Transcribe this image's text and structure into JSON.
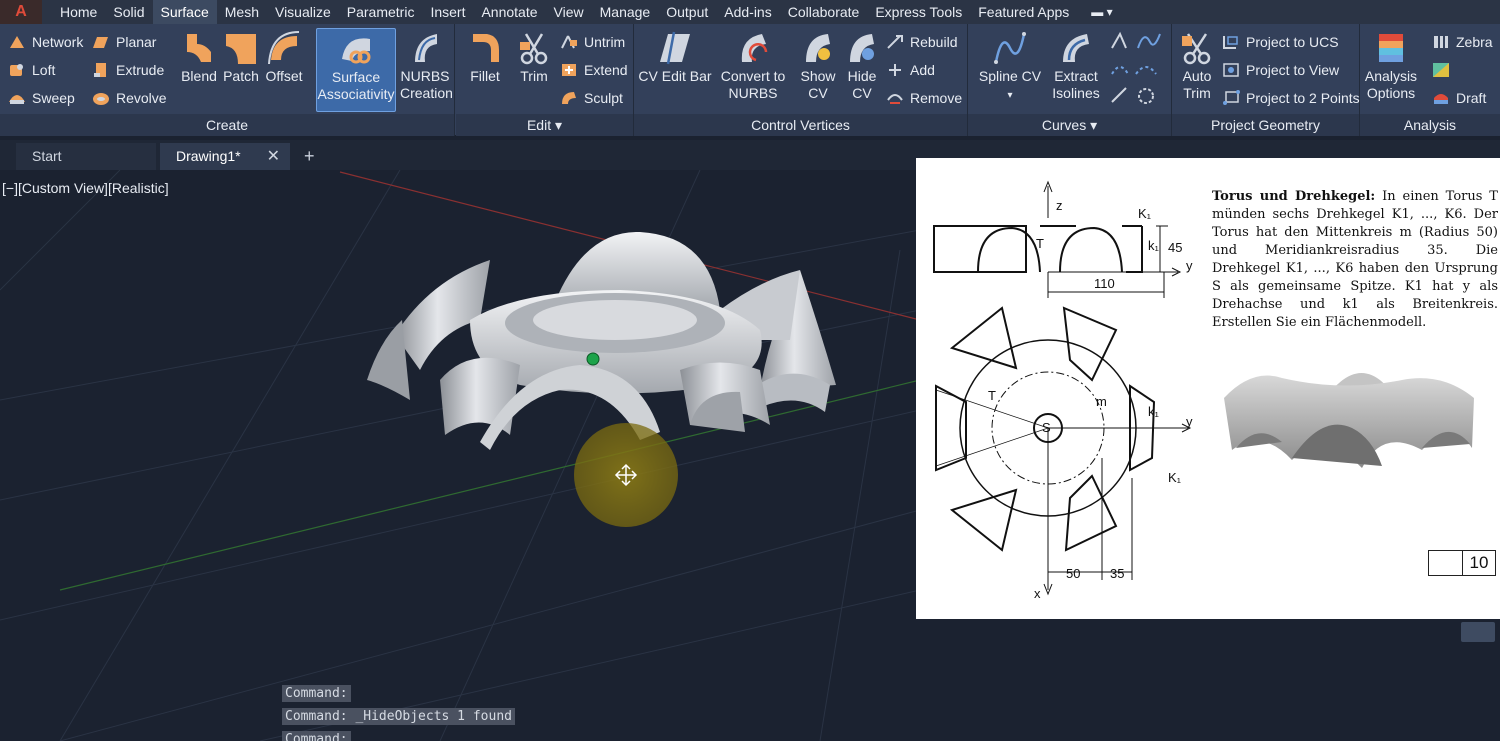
{
  "menu": {
    "tabs": [
      "Home",
      "Solid",
      "Surface",
      "Mesh",
      "Visualize",
      "Parametric",
      "Insert",
      "Annotate",
      "View",
      "Manage",
      "Output",
      "Add-ins",
      "Collaborate",
      "Express Tools",
      "Featured Apps"
    ],
    "active": "Surface"
  },
  "ribbon": {
    "create": {
      "title": "Create",
      "network": "Network",
      "loft": "Loft",
      "sweep": "Sweep",
      "planar": "Planar",
      "extrude": "Extrude",
      "revolve": "Revolve",
      "blend": "Blend",
      "patch": "Patch",
      "offset": "Offset",
      "surface_assoc_1": "Surface",
      "surface_assoc_2": "Associativity",
      "nurbs_1": "NURBS",
      "nurbs_2": "Creation"
    },
    "edit": {
      "title": "Edit",
      "fillet": "Fillet",
      "trim": "Trim",
      "untrim": "Untrim",
      "extend": "Extend",
      "sculpt": "Sculpt"
    },
    "cv": {
      "title": "Control Vertices",
      "cv_edit_bar": "CV Edit Bar",
      "convert_1": "Convert to",
      "convert_2": "NURBS",
      "show_1": "Show",
      "show_2": "CV",
      "hide_1": "Hide",
      "hide_2": "CV",
      "rebuild": "Rebuild",
      "add": "Add",
      "remove": "Remove"
    },
    "curves": {
      "title": "Curves",
      "spline_cv": "Spline CV",
      "extract_1": "Extract",
      "extract_2": "Isolines"
    },
    "project": {
      "title": "Project Geometry",
      "auto_1": "Auto",
      "auto_2": "Trim",
      "to_ucs": "Project to UCS",
      "to_view": "Project to View",
      "to_2pts": "Project to 2 Points"
    },
    "analysis": {
      "title": "Analysis",
      "options_1": "Analysis",
      "options_2": "Options",
      "zebra": "Zebra",
      "draft": "Draft"
    }
  },
  "doctabs": {
    "start": "Start",
    "drawing": "Drawing1*"
  },
  "viewport": {
    "label": "[−][Custom View][Realistic]"
  },
  "commands": [
    "Command:",
    "Command: _HideObjects 1 found",
    "Command:"
  ],
  "reference": {
    "title": "Torus und Drehkegel:",
    "body": "In einen Torus T münden sechs Drehkegel K1, ..., K6. Der Torus hat den Mittenkreis m (Radius 50) und Meridiankreisradius 35. Die Drehkegel K1, ..., K6 haben den Ursprung S als gemeinsame Spitze. K1 hat y als Drehachse und k1 als Breitenkreis. Erstellen Sie ein Flächenmodell.",
    "dims": {
      "d110": "110",
      "d45": "45",
      "d50": "50",
      "d35": "35"
    },
    "labels": {
      "z": "z",
      "y": "y",
      "x": "x",
      "T": "T",
      "K1": "K₁",
      "k1": "k₁",
      "m": "m",
      "S": "S"
    },
    "page_number": "10"
  },
  "colors": {
    "accent": "#3d6aa8",
    "ribbon": "#33405a",
    "viewport": "#1b2230"
  }
}
